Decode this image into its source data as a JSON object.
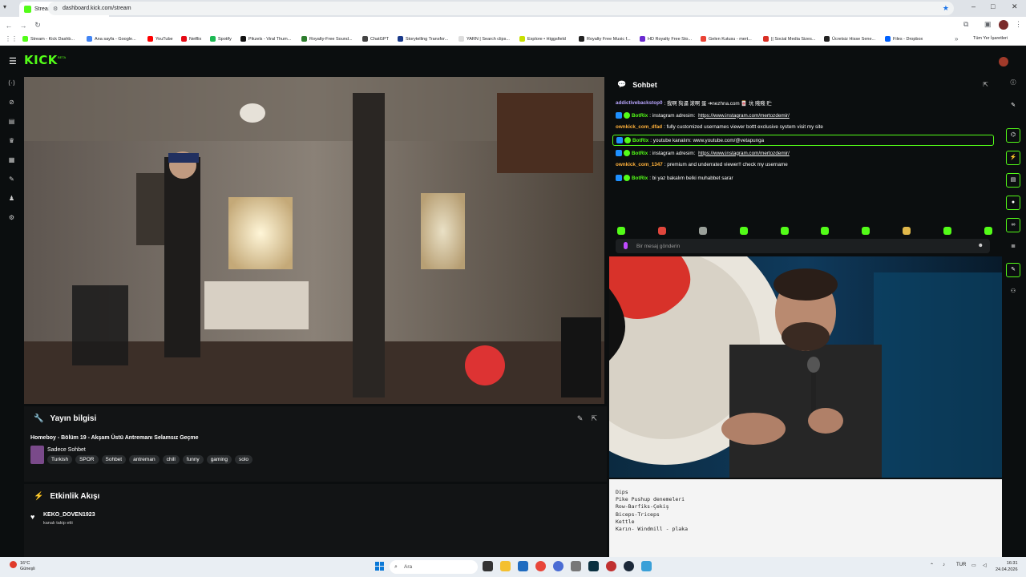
{
  "browser": {
    "tab_title": "Stream - Kick Dashboard",
    "tab_close": "×",
    "new_tab": "+",
    "url": "dashboard.kick.com/stream",
    "bookmarks": [
      {
        "label": "Stream - Kick Dashb...",
        "color": "#53fc18"
      },
      {
        "label": "Ana sayfa - Google...",
        "color": "#4285f4"
      },
      {
        "label": "YouTube",
        "color": "#ff0000"
      },
      {
        "label": "Netflix",
        "color": "#e50914"
      },
      {
        "label": "Spotify",
        "color": "#1db954"
      },
      {
        "label": "Pikzels - Viral Thum...",
        "color": "#111111"
      },
      {
        "label": "Royalty-Free Sound...",
        "color": "#2d7d2d"
      },
      {
        "label": "ChatGPT",
        "color": "#444444"
      },
      {
        "label": "Storytelling Transfor...",
        "color": "#1a3a8a"
      },
      {
        "label": "YARN | Search clips...",
        "color": "#dddddd"
      },
      {
        "label": "Explore • Higgsfield",
        "color": "#c8e000"
      },
      {
        "label": "Royalty Free Music f...",
        "color": "#222222"
      },
      {
        "label": "HD Royalty Free Sto...",
        "color": "#6a2ad0"
      },
      {
        "label": "Gelen Kutusu - mert...",
        "color": "#ea4335"
      },
      {
        "label": "|| Social Media Sizes...",
        "color": "#d93025"
      },
      {
        "label": "Ücretsiz Hisse Sene...",
        "color": "#222222"
      },
      {
        "label": "Files - Dropbox",
        "color": "#0061fe"
      }
    ],
    "all_bookmarks": "Tüm Yer İşaretleri",
    "more": "»"
  },
  "kick": {
    "logo": "KICK",
    "beta": "BETA"
  },
  "stream_info": {
    "title": "Yayın bilgisi",
    "stream_title": "Homeboy - Bölüm 19 - Akşam Üstü Antremanı Selamsız Geçme",
    "category": "Sadece Sohbet",
    "tags": [
      "Turkish",
      "SPOR",
      "Sohbet",
      "antreman",
      "chill",
      "funny",
      "gaming",
      "solo"
    ]
  },
  "activity": {
    "title": "Etkinlik Akışı",
    "user": "KEKO_DOVEN1923",
    "action": "kanalı takip etti"
  },
  "chat": {
    "title": "Sohbet",
    "messages": [
      {
        "user": "addictivebackstop0",
        "user_color": "#b9a6ff",
        "badges": false,
        "text": ": 我啊 狗逼 滚啊 蛋 ➔nezhna.com 🀄 坑 賤賤 贮",
        "link": "",
        "highlight": false
      },
      {
        "user": "BotRix",
        "user_color": "#53fc18",
        "badges": true,
        "text": ": instagram adresim: ",
        "link": "https://www.instagram.com/mertozdemir/",
        "highlight": false
      },
      {
        "user": "ownkick_com_dfad",
        "user_color": "#ffb13b",
        "badges": false,
        "text": ": fully customized usernames viewer bottt exclusive system visit my site",
        "link": "",
        "highlight": false
      },
      {
        "user": "BotRix",
        "user_color": "#53fc18",
        "badges": true,
        "text": ": youtube kanalım: www.youtube.com/@vetapunga",
        "link": "",
        "highlight": true
      },
      {
        "user": "BotRix",
        "user_color": "#53fc18",
        "badges": true,
        "text": ": instagram adresim: ",
        "link": "https://www.instagram.com/mertozdemir/",
        "highlight": false
      },
      {
        "user": "ownkick_com_1347",
        "user_color": "#ffb13b",
        "badges": false,
        "text": ": premium and underrated viewer!! check my username",
        "link": "",
        "highlight": false
      },
      {
        "user": "BotRix",
        "user_color": "#53fc18",
        "badges": true,
        "text": ": bi yaz bakalım belki muhabbet sarar",
        "link": "",
        "highlight": false
      }
    ],
    "emotes": [
      "#53fc18",
      "#e0463c",
      "#9aa09a",
      "#53fc18",
      "#53fc18",
      "#53fc18",
      "#53fc18",
      "#e0b84a",
      "#53fc18",
      "#53fc18"
    ],
    "input_placeholder": "Bir mesaj gönderin"
  },
  "notes": {
    "lines": [
      "Dips",
      "Pike Pushup denemeleri",
      "Row-Barfiks-Çekiş",
      "Biceps-Triceps",
      "Kettle",
      "Karın- Windmill - plaka"
    ]
  },
  "taskbar": {
    "temp": "16°C",
    "weather": "Güneşli",
    "search": "Ara",
    "lang": "TUR",
    "time": "16:31",
    "date": "24.04.2026"
  }
}
